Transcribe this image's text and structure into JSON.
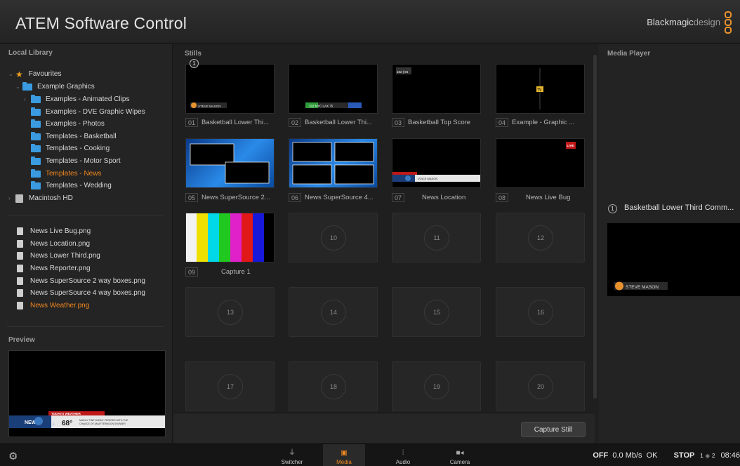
{
  "title_bar": {
    "app_title": "ATEM Software Control",
    "brand_name_bold": "Blackmagic",
    "brand_name_light": "design"
  },
  "local_library": {
    "label": "Local Library",
    "tree": [
      {
        "label": "Favourites",
        "icon": "star-icon"
      },
      {
        "label": "Example Graphics",
        "icon": "folder-icon"
      },
      {
        "label": "Examples - Animated Clips",
        "icon": "folder-icon"
      },
      {
        "label": "Examples - DVE Graphic Wipes",
        "icon": "folder-icon"
      },
      {
        "label": "Examples - Photos",
        "icon": "folder-icon"
      },
      {
        "label": "Templates - Basketball",
        "icon": "folder-icon"
      },
      {
        "label": "Templates - Cooking",
        "icon": "folder-icon"
      },
      {
        "label": "Templates - Motor Sport",
        "icon": "folder-icon"
      },
      {
        "label": "Templates - News",
        "icon": "folder-icon",
        "selected": true
      },
      {
        "label": "Templates - Wedding",
        "icon": "folder-icon"
      },
      {
        "label": "Macintosh HD",
        "icon": "drive-icon"
      }
    ],
    "files": [
      {
        "label": "News Live Bug.png"
      },
      {
        "label": "News Location.png"
      },
      {
        "label": "News Lower Third.png"
      },
      {
        "label": "News Reporter.png"
      },
      {
        "label": "News SuperSource 2 way boxes.png"
      },
      {
        "label": "News SuperSource 4 way boxes.png"
      },
      {
        "label": "News Weather.png",
        "selected": true
      }
    ]
  },
  "preview": {
    "label": "Preview",
    "weather_banner": "TODAYS WEATHER",
    "temp": "68°",
    "forecast_line1": "MAINLY FINE SUNNY PERIODS WITH THE",
    "forecast_line2": "CHANCE OF AN AFTERNOON SHOWER",
    "logo": "NEWS"
  },
  "stills": {
    "label": "Stills",
    "marker": "1",
    "items": [
      {
        "num": "01",
        "label": "Basketball Lower Thi..."
      },
      {
        "num": "02",
        "label": "Basketball Lower Thi..."
      },
      {
        "num": "03",
        "label": "Basketball Top Score"
      },
      {
        "num": "04",
        "label": "Example - Graphic ..."
      },
      {
        "num": "05",
        "label": "News SuperSource 2..."
      },
      {
        "num": "06",
        "label": "News SuperSource 4..."
      },
      {
        "num": "07",
        "label": "News Location"
      },
      {
        "num": "08",
        "label": "News Live Bug"
      },
      {
        "num": "09",
        "label": "Capture 1"
      }
    ],
    "empty_slots": [
      "10",
      "11",
      "12",
      "13",
      "14",
      "15",
      "16",
      "17",
      "18",
      "19",
      "20"
    ],
    "thumb_text": {
      "steve_mason": "STEVE MASON",
      "score_line": "102 NYC LAX 75",
      "top_score": "102 | 94",
      "tv": "TV",
      "live": "LIVE",
      "voice": "VOICE MASON"
    },
    "capture_button": "Capture Still"
  },
  "media_player": {
    "label": "Media Player",
    "slot_number": "1",
    "title": "Basketball Lower Third Comm...",
    "thumb_name": "STEVE MASON"
  },
  "bottom_bar": {
    "tabs": [
      {
        "label": "Switcher",
        "icon": "switcher-icon"
      },
      {
        "label": "Media",
        "icon": "media-icon",
        "active": true
      },
      {
        "label": "Audio",
        "icon": "audio-icon"
      },
      {
        "label": "Camera",
        "icon": "camera-icon"
      }
    ],
    "status": {
      "off": "OFF",
      "rate": "0.0 Mb/s",
      "ok": "OK",
      "stop": "STOP",
      "ch1": "1",
      "ch2": "2",
      "time": "08:46"
    }
  },
  "colors": {
    "accent": "#f0871e",
    "folder": "#3a9be0",
    "background": "#202020"
  }
}
